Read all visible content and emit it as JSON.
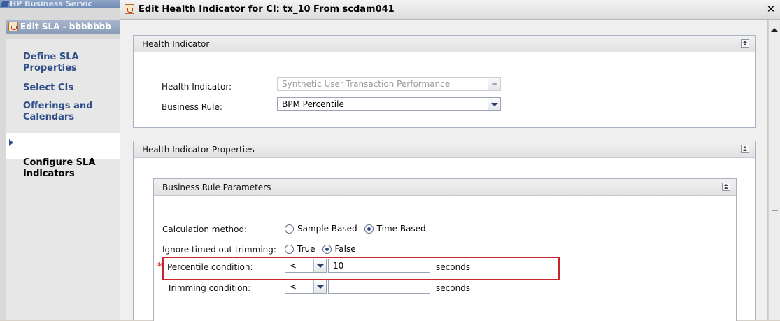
{
  "background_window": {
    "title": "HP Business Servic",
    "sla_window_title": "Edit SLA - bbbbbbb",
    "nav_items": [
      {
        "label": "Define SLA\nProperties",
        "active": false
      },
      {
        "label": "Select CIs",
        "active": false
      },
      {
        "label": "Offerings and\nCalendars",
        "active": false
      },
      {
        "label": "Configure SLA\nIndicators",
        "active": true
      }
    ]
  },
  "dialog": {
    "title": "Edit Health Indicator for CI: tx_10 From scdam041",
    "close_icon": "close-icon",
    "health_indicator_panel": {
      "header": "Health Indicator",
      "health_indicator_label": "Health Indicator:",
      "health_indicator_value": "Synthetic User Transaction Performance",
      "business_rule_label": "Business Rule:",
      "business_rule_value": "BPM Percentile"
    },
    "properties_panel": {
      "header": "Health Indicator Properties",
      "parameters_panel": {
        "header": "Business Rule Parameters",
        "calculation_method_label": "Calculation method:",
        "calculation_method_options": [
          "Sample Based",
          "Time Based"
        ],
        "calculation_method_selected": "Time Based",
        "ignore_trimming_label": "Ignore timed out trimming:",
        "ignore_trimming_options": [
          "True",
          "False"
        ],
        "ignore_trimming_selected": "False",
        "percentile_condition_label": "Percentile condition:",
        "percentile_operator": "<",
        "percentile_value": "10",
        "percentile_unit": "seconds",
        "trimming_condition_label": "Trimming condition:",
        "trimming_operator": "<",
        "trimming_value": "",
        "trimming_unit": "seconds"
      }
    }
  },
  "colors": {
    "highlight": "#c8252b",
    "required_star": "#d33333",
    "nav_link": "#2f4f8a"
  }
}
